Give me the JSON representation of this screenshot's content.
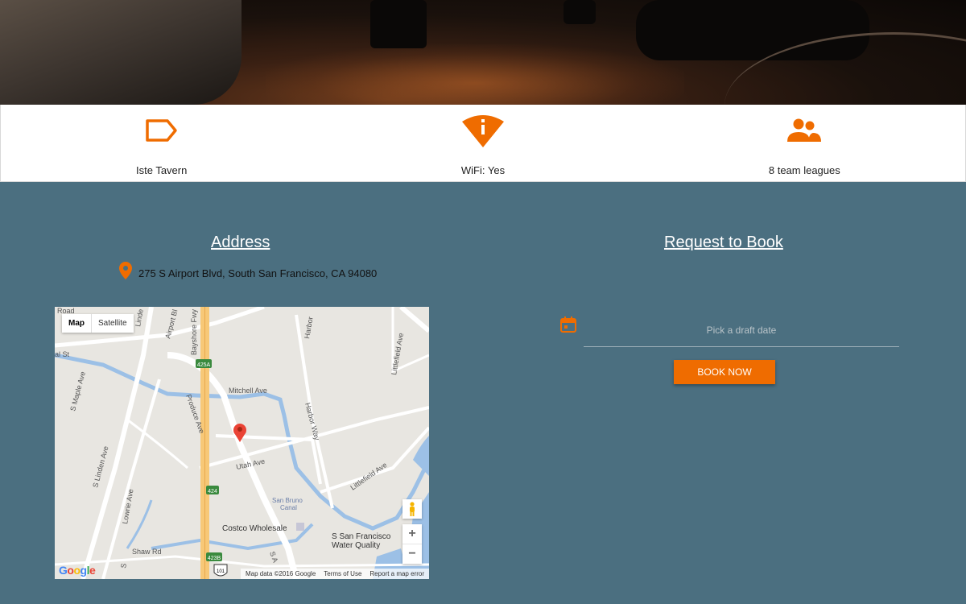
{
  "amenities": [
    {
      "icon": "label-tag-icon",
      "label": "Iste Tavern"
    },
    {
      "icon": "wifi-info-icon",
      "label": "WiFi: Yes"
    },
    {
      "icon": "people-icon",
      "label": "8 team leagues"
    }
  ],
  "address": {
    "title": "Address",
    "icon": "location-pin-icon",
    "text": "275 S Airport Blvd, South San Francisco, CA 94080"
  },
  "map": {
    "type_buttons": [
      "Map",
      "Satellite"
    ],
    "labels": {
      "mitchell": "Mitchell Ave",
      "utah": "Utah Ave",
      "harbor_way": "Harbor Way",
      "littlefield_top": "Littlefield Ave",
      "littlefield_bottom": "Littlefield Ave",
      "produce": "Produce Ave",
      "linden": "S Linden Ave",
      "maple": "S Maple Ave",
      "lowrie": "Lowrie Ave",
      "shaw": "Shaw Rd",
      "airport": "Airport Bl",
      "bayshore": "Bayshore Fwy",
      "harbor_top": "Harbor",
      "costco": "Costco Wholesale",
      "water1": "S San Francisco",
      "water2": "Water Quality",
      "canal1": "San Bruno",
      "canal2": "Canal",
      "shield_425a": "425A",
      "shield_424": "424",
      "shield_423b": "423B",
      "shield_101": "101",
      "road_top": "Road",
      "sa_label": "S A",
      "s_label": "S",
      "linden_top": "Linde",
      "al_st": "al St"
    },
    "zoom_in": "+",
    "zoom_out": "−",
    "google": "Google",
    "footer": [
      "Map data ©2016 Google",
      "Terms of Use",
      "Report a map error"
    ]
  },
  "booking": {
    "title": "Request to Book",
    "calendar_icon": "calendar-icon",
    "date_placeholder": "Pick a draft date",
    "button": "BOOK NOW"
  },
  "colors": {
    "accent": "#ef6c00",
    "section_bg": "#4b6f80"
  }
}
